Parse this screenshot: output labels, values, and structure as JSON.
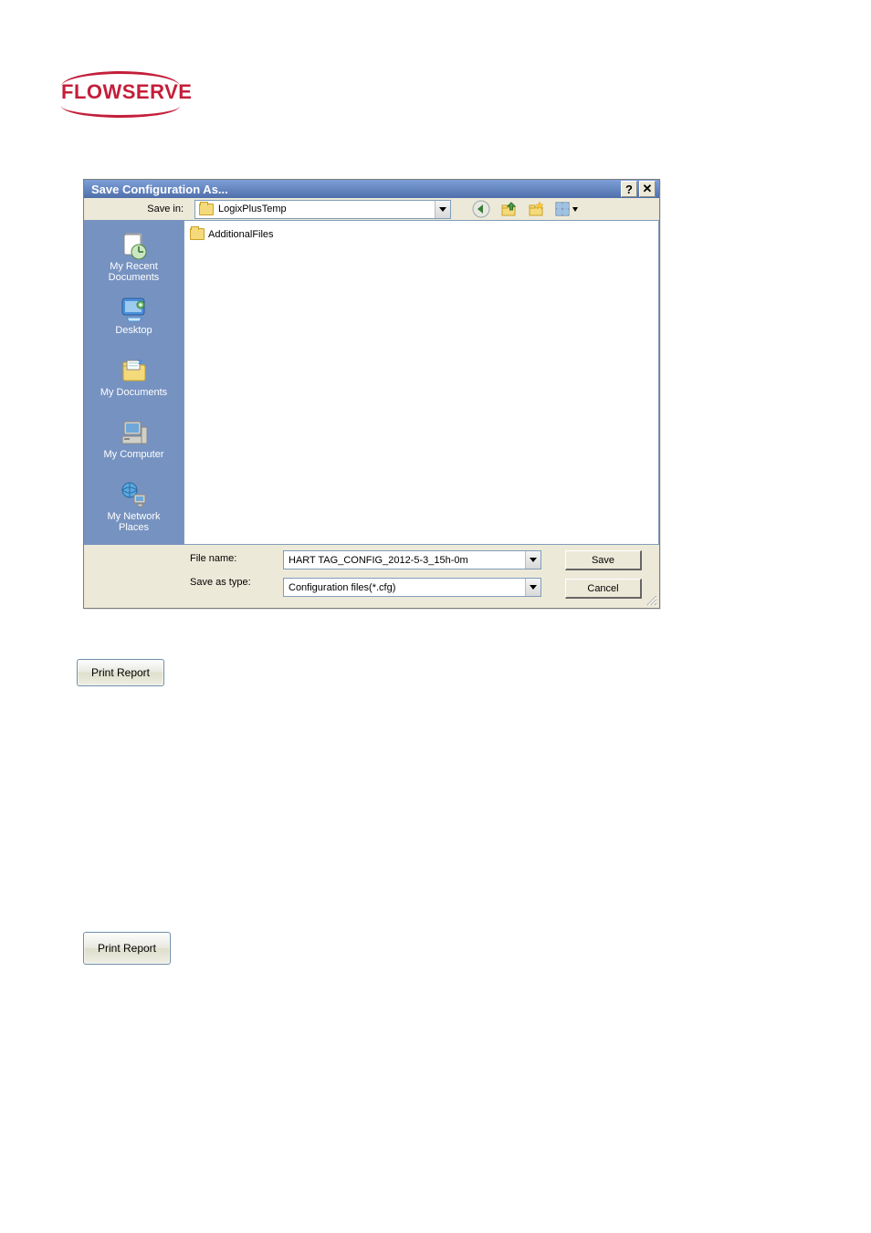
{
  "brand": {
    "name": "FLOWSERVE"
  },
  "dialog": {
    "title": "Save Configuration As...",
    "savein_label": "Save in:",
    "savein_value": "LogixPlusTemp",
    "file_list": [
      {
        "name": "AdditionalFiles"
      }
    ],
    "filename_label": "File name:",
    "filename_value": "HART TAG_CONFIG_2012-5-3_15h-0m",
    "filetype_label": "Save as type:",
    "filetype_value": "Configuration files(*.cfg)",
    "save_button": "Save",
    "cancel_button": "Cancel",
    "help_button": "?",
    "close_button": "✕"
  },
  "places": [
    {
      "label": "My Recent\nDocuments",
      "icon": "recent"
    },
    {
      "label": "Desktop",
      "icon": "desktop"
    },
    {
      "label": "My Documents",
      "icon": "documents"
    },
    {
      "label": "My Computer",
      "icon": "computer"
    },
    {
      "label": "My Network\nPlaces",
      "icon": "network"
    }
  ],
  "buttons": {
    "print_report": "Print Report"
  }
}
